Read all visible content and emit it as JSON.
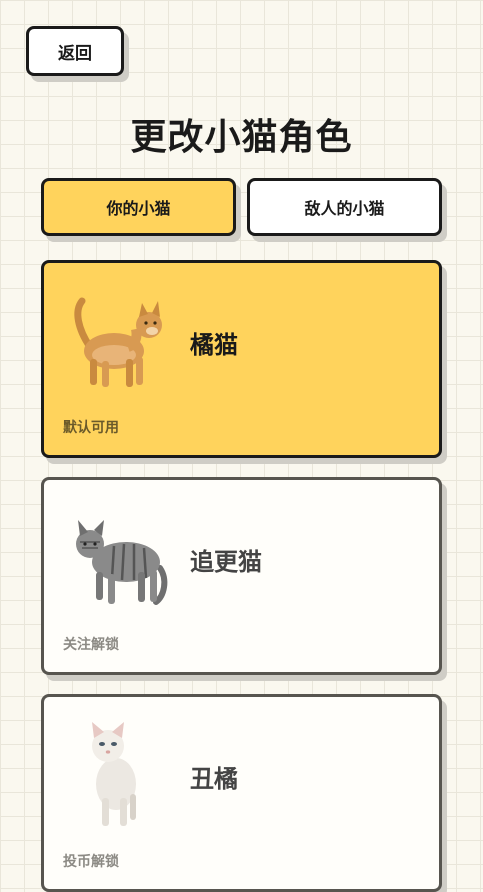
{
  "header": {
    "back_label": "返回",
    "title": "更改小猫角色"
  },
  "tabs": [
    {
      "label": "你的小猫",
      "active": true
    },
    {
      "label": "敌人的小猫",
      "active": false
    }
  ],
  "cats": [
    {
      "name": "橘猫",
      "status": "默认可用",
      "selected": true,
      "icon": "orange-cat-icon"
    },
    {
      "name": "追更猫",
      "status": "关注解锁",
      "selected": false,
      "icon": "gray-tabby-cat-icon"
    },
    {
      "name": "丑橘",
      "status": "投币解锁",
      "selected": false,
      "icon": "white-cat-icon"
    }
  ],
  "colors": {
    "accent": "#ffd35c",
    "border": "#1a1a1a",
    "background": "#faf8ef"
  }
}
